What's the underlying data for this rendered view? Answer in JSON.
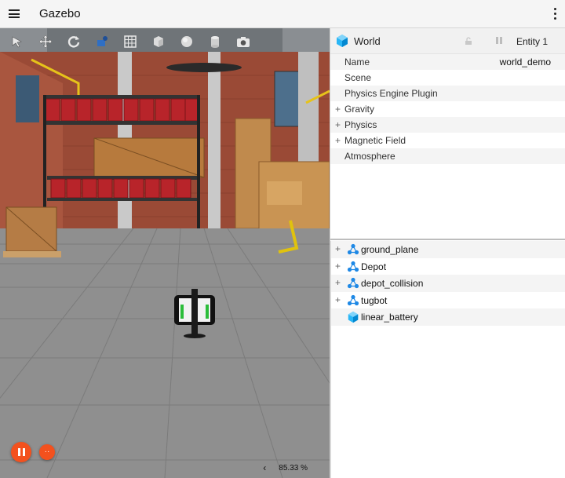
{
  "app": {
    "title": "Gazebo"
  },
  "toolbar": {
    "tools": [
      {
        "name": "select-tool-icon"
      },
      {
        "name": "translate-tool-icon"
      },
      {
        "name": "rotate-tool-icon"
      },
      {
        "name": "transform-control-icon"
      },
      {
        "name": "grid-config-icon"
      },
      {
        "name": "box-shape-icon"
      },
      {
        "name": "sphere-shape-icon"
      },
      {
        "name": "cylinder-shape-icon"
      },
      {
        "name": "screenshot-camera-icon"
      }
    ]
  },
  "playback": {
    "stats_toggle": "‹",
    "real_time_factor": "85.33 %"
  },
  "component_inspector": {
    "title": "World",
    "entity_label": "Entity 1",
    "rows": [
      {
        "label": "Name",
        "value": "world_demo",
        "expandable": false
      },
      {
        "label": "Scene",
        "value": "",
        "expandable": false
      },
      {
        "label": "Physics Engine Plugin",
        "value": "",
        "expandable": false
      },
      {
        "label": "Gravity",
        "value": "",
        "expandable": true
      },
      {
        "label": "Physics",
        "value": "",
        "expandable": true
      },
      {
        "label": "Magnetic Field",
        "value": "",
        "expandable": true
      },
      {
        "label": "Atmosphere",
        "value": "",
        "expandable": false
      }
    ]
  },
  "entity_tree": {
    "items": [
      {
        "label": "ground_plane",
        "type": "model",
        "expandable": true
      },
      {
        "label": "Depot",
        "type": "model",
        "expandable": true
      },
      {
        "label": "depot_collision",
        "type": "model",
        "expandable": true
      },
      {
        "label": "tugbot",
        "type": "model",
        "expandable": true
      },
      {
        "label": "linear_battery",
        "type": "light",
        "expandable": false
      }
    ]
  },
  "colors": {
    "accent_orange": "#f3511e",
    "entity_blue": "#1e88e5",
    "panel_header": "#f1f1f1"
  }
}
